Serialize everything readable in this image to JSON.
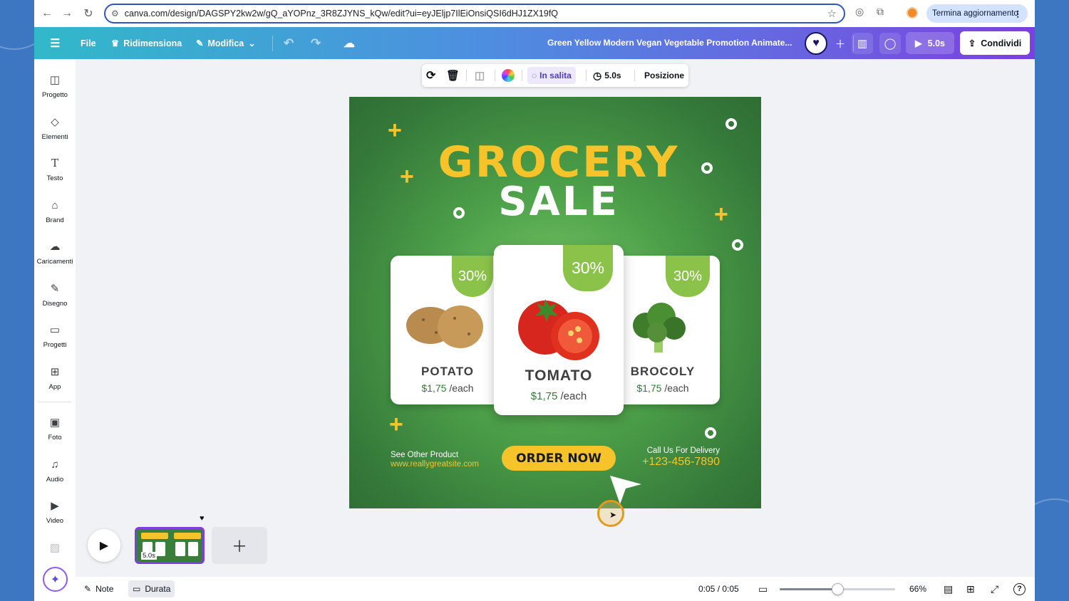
{
  "browser": {
    "url": "canva.com/design/DAGSPY2kw2w/gQ_aYOPnz_3R8ZJYNS_kQw/edit?ui=eyJEljp7IlEiOnsiQSI6dHJ1ZX19fQ",
    "update_label": "Termina aggiornamento"
  },
  "header": {
    "file": "File",
    "resize": "Ridimensiona",
    "edit": "Modifica",
    "doc_title": "Green Yellow Modern Vegan Vegetable Promotion Animate...",
    "duration": "5.0s",
    "share": "Condividi"
  },
  "sidebar": {
    "items": [
      {
        "label": "Progetto",
        "icon": "layout-icon"
      },
      {
        "label": "Elementi",
        "icon": "elements-icon"
      },
      {
        "label": "Testo",
        "icon": "text-icon"
      },
      {
        "label": "Brand",
        "icon": "brand-icon"
      },
      {
        "label": "Caricamenti",
        "icon": "upload-cloud-icon"
      },
      {
        "label": "Disegno",
        "icon": "draw-icon"
      },
      {
        "label": "Progetti",
        "icon": "folder-icon"
      },
      {
        "label": "App",
        "icon": "apps-icon"
      },
      {
        "label": "Foto",
        "icon": "photo-icon"
      },
      {
        "label": "Audio",
        "icon": "music-icon"
      },
      {
        "label": "Video",
        "icon": "video-icon"
      }
    ]
  },
  "toolbar": {
    "animation": "In salita",
    "timing": "5.0s",
    "position": "Posizione"
  },
  "design": {
    "title_line1": "GROCERY",
    "title_line2": "SALE",
    "products": [
      {
        "badge": "30%",
        "name": "POTATO",
        "price": "$1,75",
        "unit": "/each"
      },
      {
        "badge": "30%",
        "name": "TOMATO",
        "price": "$1,75",
        "unit": "/each"
      },
      {
        "badge": "30%",
        "name": "BROCOLY",
        "price": "$1,75",
        "unit": "/each"
      }
    ],
    "see_other": "See Other Product",
    "website": "www.reallygreatsite.com",
    "order": "ORDER NOW",
    "call": "Call Us For Delivery",
    "phone": "+123-456-7890"
  },
  "timeline": {
    "thumb_duration": "5.0s",
    "thumb_title": "GROCERY SALE"
  },
  "bottom": {
    "notes": "Note",
    "durata": "Durata",
    "time": "0:05 / 0:05",
    "zoom": "66%",
    "zoom_fraction": 0.5
  },
  "colors": {
    "accent": "#7d3fe0",
    "design_green": "#357a3a",
    "design_yellow": "#f6c42a",
    "badge_green": "#8bc34a"
  }
}
